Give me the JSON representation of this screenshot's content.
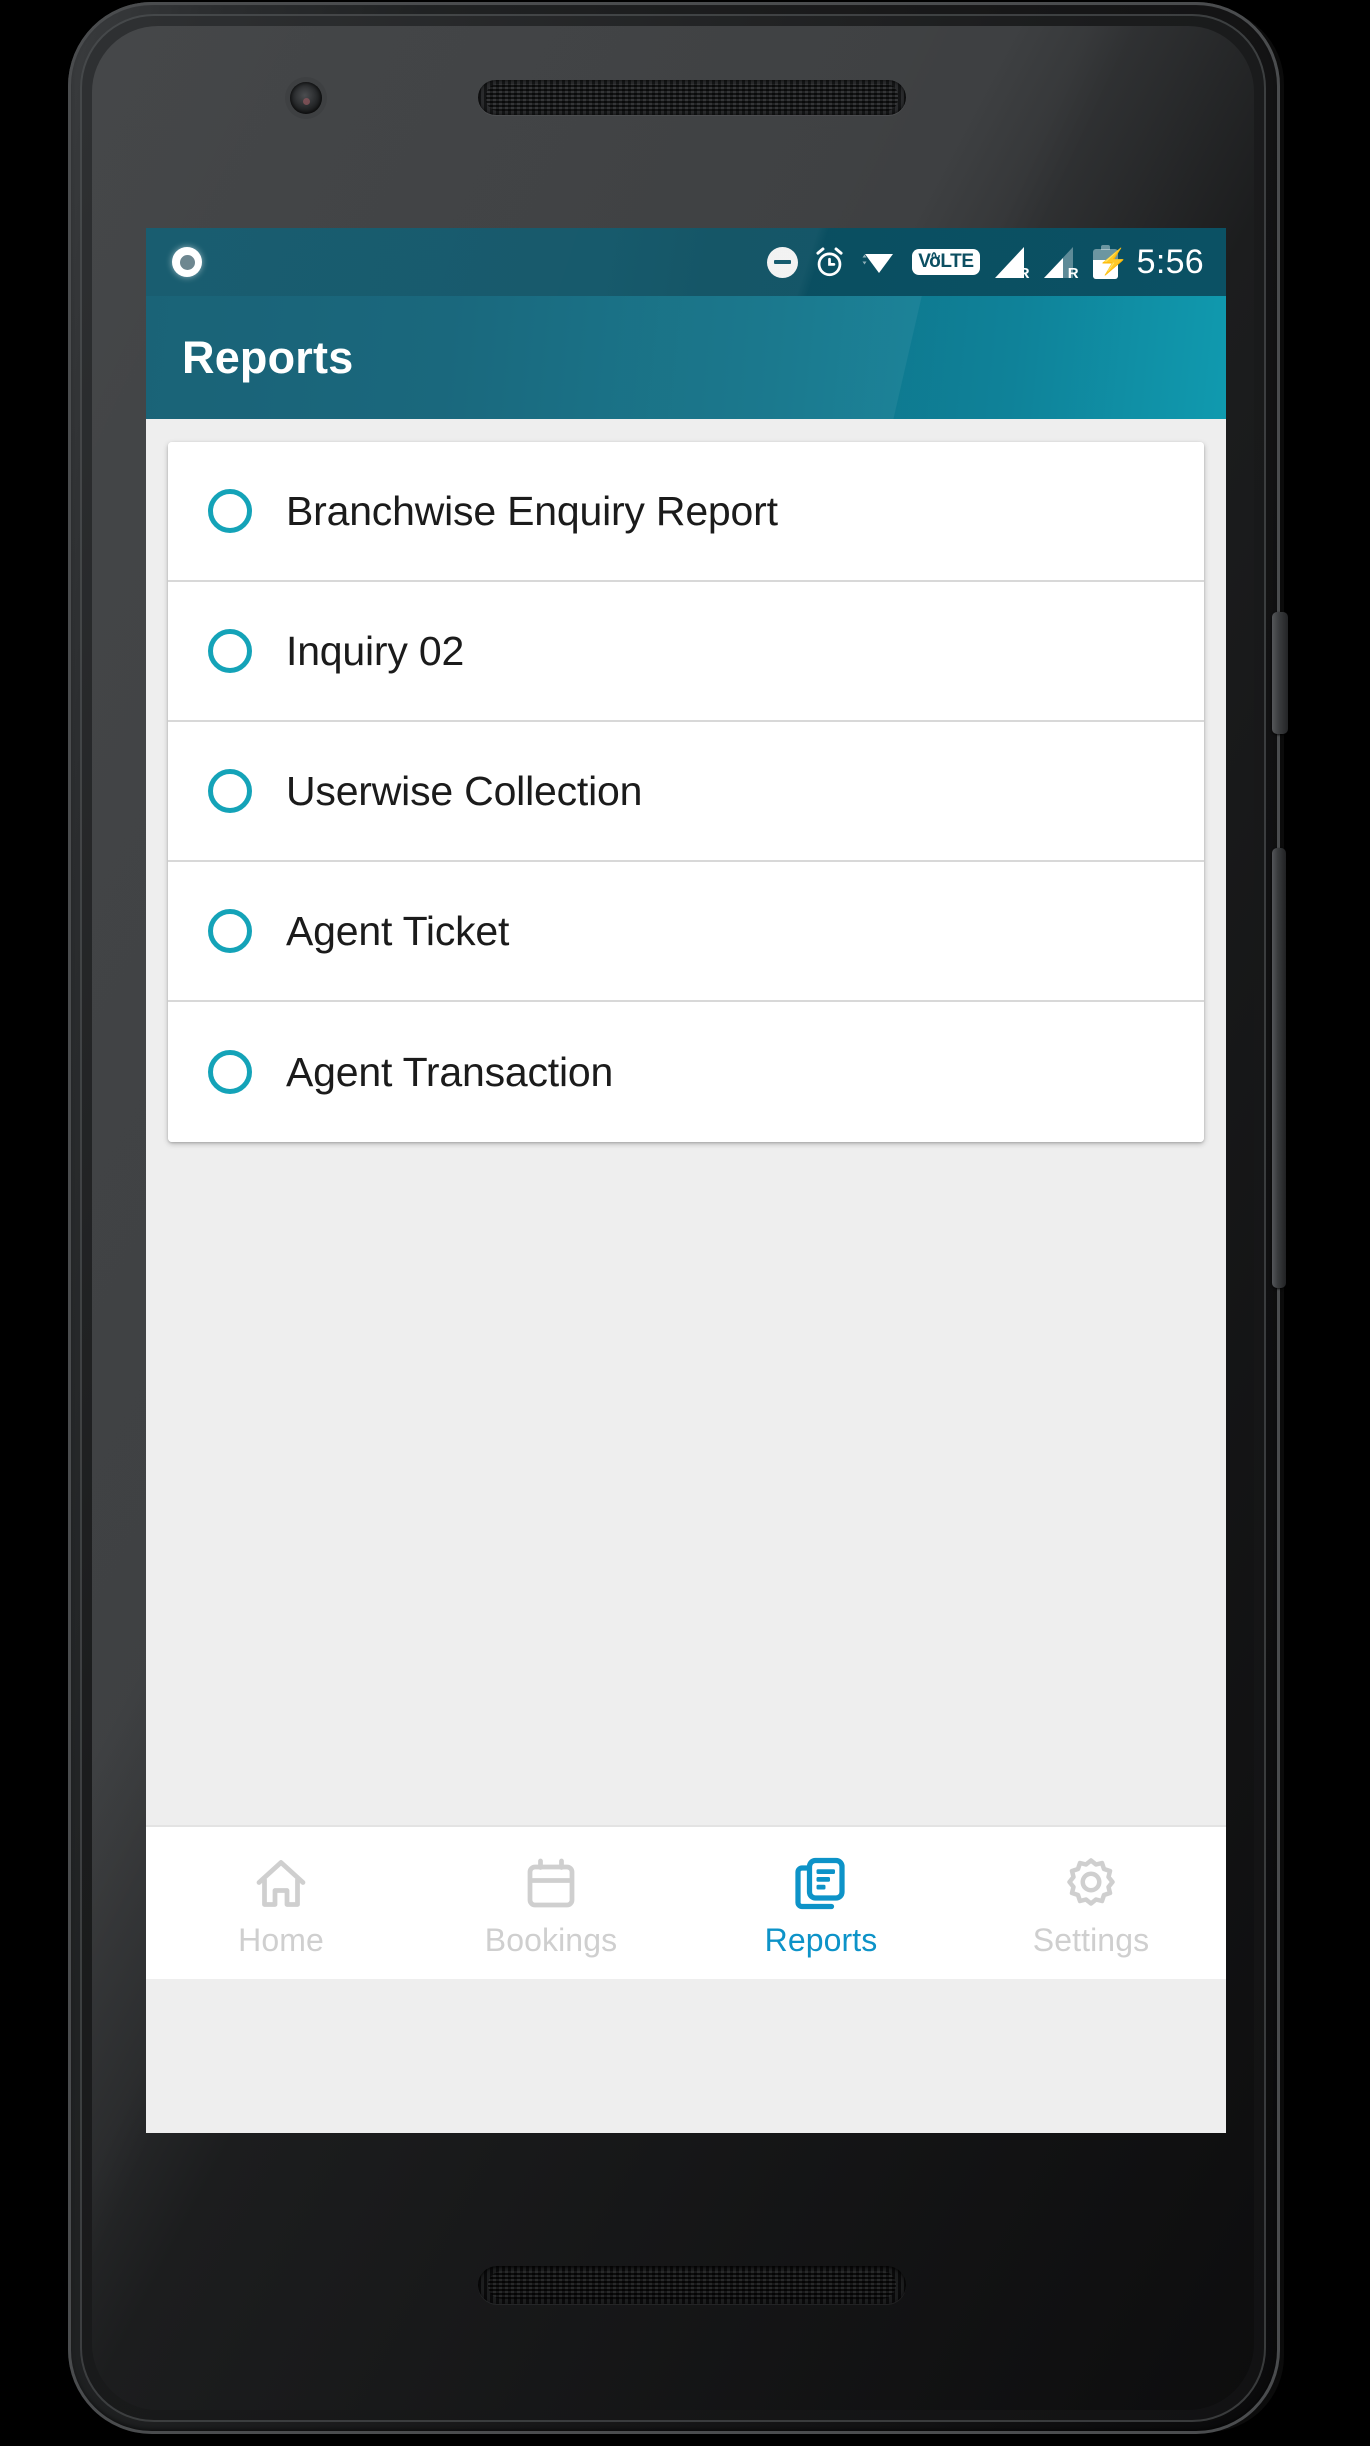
{
  "device": {
    "frame": "android-phone",
    "hardware": {
      "front_camera": "front-camera",
      "earpiece": "earpiece-grille",
      "bottom_speaker": "speaker-grille",
      "power_button": "power-button",
      "volume_button": "volume-rocker"
    }
  },
  "colors": {
    "accent_teal": "#14a3b8",
    "appbar_gradient_start": "#0d5a70",
    "appbar_gradient_end": "#109aaf",
    "statusbar": "#0c5468",
    "active_nav": "#0d93c8",
    "inactive_nav": "#cfcfcf",
    "screen_background": "#eeeeee",
    "card_background": "#ffffff",
    "divider": "#d8d8d8",
    "text_primary": "#1b1b1b"
  },
  "status_bar": {
    "time": "5:56",
    "icons": [
      "notification-circle-icon",
      "do-not-disturb-icon",
      "alarm-icon",
      "wifi-icon",
      "volte-icon",
      "signal-sim1-roaming-icon",
      "signal-sim2-roaming-icon",
      "battery-charging-icon"
    ],
    "volte_label": "LTE",
    "volte_prefix": "V",
    "volte_o": "o",
    "roaming_label": "R"
  },
  "app_bar": {
    "title": "Reports"
  },
  "reports": {
    "items": [
      {
        "label": "Branchwise Enquiry Report",
        "selected": false
      },
      {
        "label": "Inquiry 02",
        "selected": false
      },
      {
        "label": "Userwise Collection",
        "selected": false
      },
      {
        "label": "Agent Ticket",
        "selected": false
      },
      {
        "label": "Agent Transaction",
        "selected": false
      }
    ]
  },
  "bottom_nav": {
    "items": [
      {
        "label": "Home",
        "icon": "home-icon",
        "active": false
      },
      {
        "label": "Bookings",
        "icon": "calendar-icon",
        "active": false
      },
      {
        "label": "Reports",
        "icon": "reports-document-icon",
        "active": true
      },
      {
        "label": "Settings",
        "icon": "gear-icon",
        "active": false
      }
    ]
  }
}
